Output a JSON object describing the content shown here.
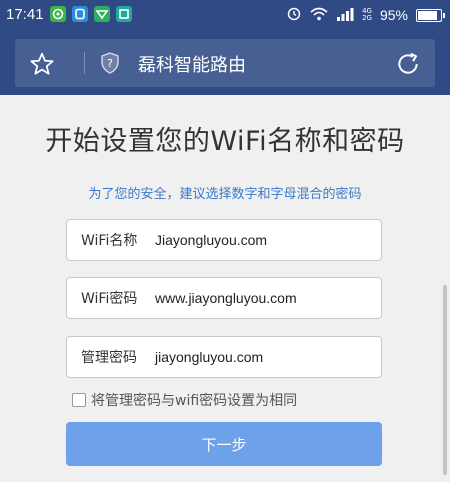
{
  "status_bar": {
    "time": "17:41",
    "battery_percent_text": "95%",
    "battery_level": 0.95,
    "network_labels": [
      "4G",
      "2G"
    ],
    "icons": [
      "wechat-icon",
      "messenger-icon",
      "vpn-icon",
      "scan-icon",
      "alarm-icon",
      "wifi-icon",
      "signal-icon",
      "battery-icon"
    ]
  },
  "browser": {
    "page_title": "磊科智能路由",
    "icons": [
      "star-icon",
      "shield-icon",
      "refresh-icon"
    ]
  },
  "page": {
    "heading": "开始设置您的WiFi名称和密码",
    "hint": "为了您的安全，建议选择数字和字母混合的密码",
    "fields": [
      {
        "label": "WiFi名称",
        "value": "Jiayongluyou.com"
      },
      {
        "label": "WiFi密码",
        "value": "www.jiayongluyou.com"
      },
      {
        "label": "管理密码",
        "value": "jiayongluyou.com"
      }
    ],
    "same_password_checkbox_label": "将管理密码与wifi密码设置为相同",
    "same_password_checked": false,
    "next_button_label": "下一步"
  },
  "colors": {
    "toolbar": "#2f4a85",
    "urlbar": "#485f94",
    "hint_text": "#3a79c9",
    "button": "#6da1ea"
  }
}
